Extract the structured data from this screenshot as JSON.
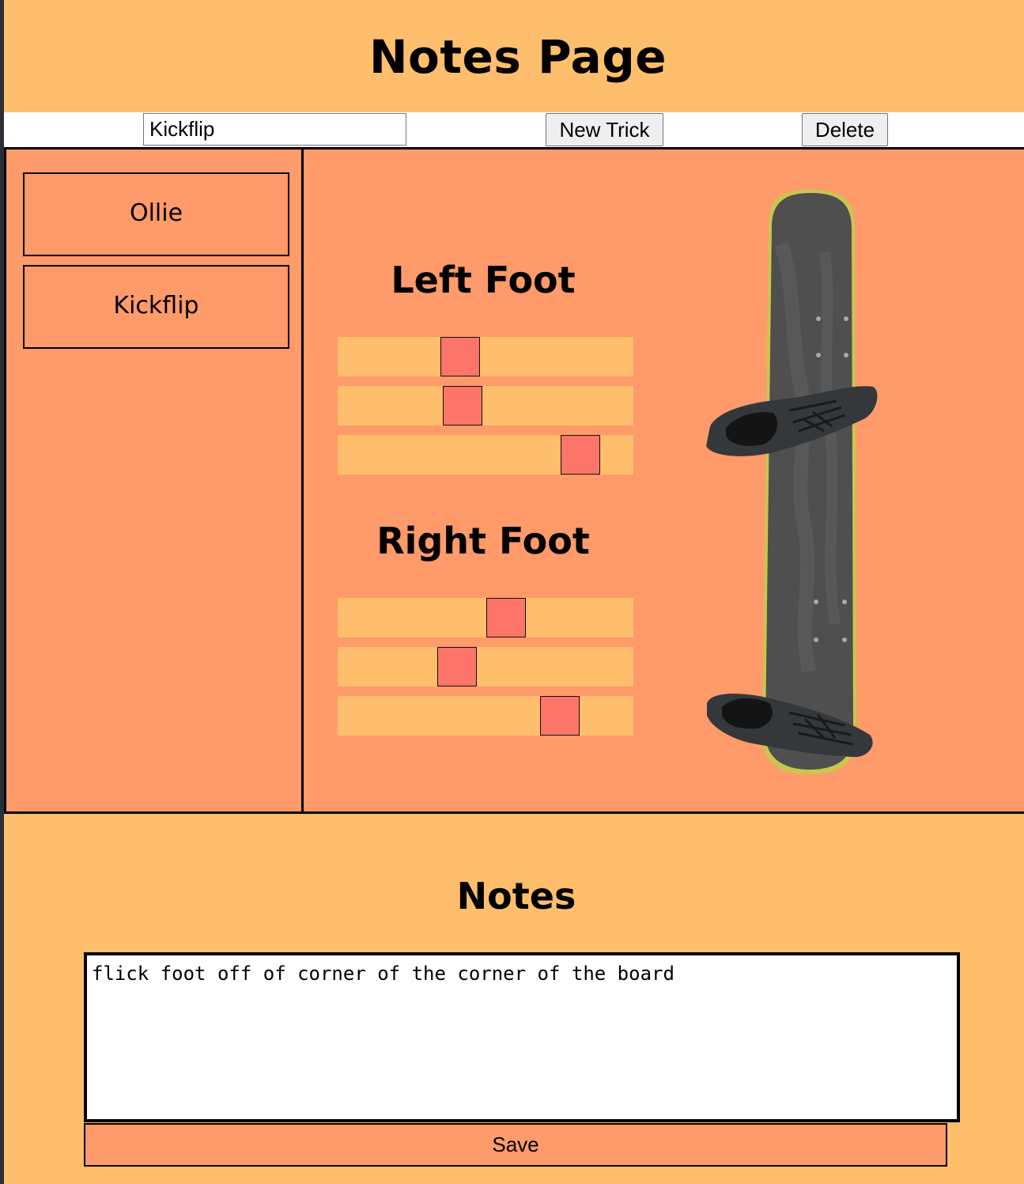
{
  "header": {
    "title": "Notes Page"
  },
  "toolbar": {
    "trick_input_value": "Kickflip",
    "new_trick_label": "New Trick",
    "delete_label": "Delete"
  },
  "tricks": [
    {
      "label": "Ollie"
    },
    {
      "label": "Kickflip"
    }
  ],
  "left_foot": {
    "heading": "Left Foot",
    "slider_values_percent": [
      40,
      41,
      87
    ]
  },
  "right_foot": {
    "heading": "Right Foot",
    "slider_values_percent": [
      58,
      39,
      79
    ]
  },
  "board_image": {
    "icon": "skateboard-with-shoes-icon"
  },
  "notes": {
    "heading": "Notes",
    "text": "flick foot off of corner of the corner of the board",
    "save_label": "Save"
  },
  "colors": {
    "background": "#ffbe6b",
    "panel": "#ff9a6a",
    "slider_thumb": "#fd7569"
  }
}
